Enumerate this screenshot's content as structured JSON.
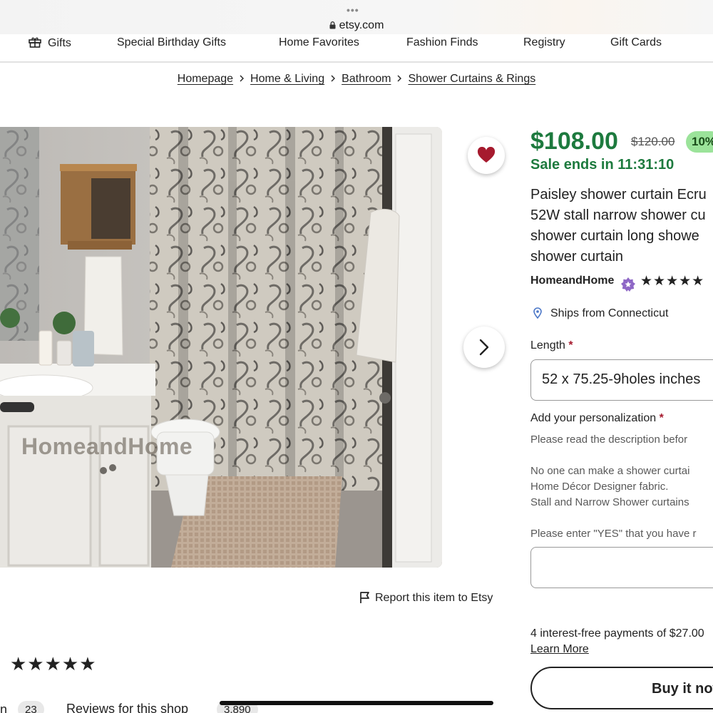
{
  "browser": {
    "url": "etsy.com"
  },
  "nav": {
    "items": [
      {
        "label": "Gifts"
      },
      {
        "label": "Special Birthday Gifts"
      },
      {
        "label": "Home Favorites"
      },
      {
        "label": "Fashion Finds"
      },
      {
        "label": "Registry"
      },
      {
        "label": "Gift Cards"
      }
    ]
  },
  "breadcrumb": [
    "Homepage",
    "Home & Living",
    "Bathroom",
    "Shower Curtains & Rings"
  ],
  "image": {
    "watermark": "HomeandHome",
    "icons": {
      "favorite": "heart-icon",
      "next": "chevron-right-icon"
    }
  },
  "report_link": "Report this item to Etsy",
  "reviews": {
    "left_fragment": "n",
    "item_count": "23",
    "shop_label": "Reviews for this shop",
    "shop_count": "3,890",
    "stars": "★★★★★"
  },
  "product": {
    "price": "$108.00",
    "original_price": "$120.00",
    "discount": "10%",
    "sale_ends": "Sale ends in 11:31:10",
    "title_lines": [
      "Paisley shower curtain Ecru",
      "52W stall narrow shower cu",
      "shower curtain long showe",
      "shower curtain"
    ],
    "shop_name": "HomeandHome",
    "shop_stars": "★★★★★",
    "ships_from": "Ships from Connecticut",
    "colors": {
      "price": "#1d7a3e",
      "discount_bg": "#9be39a",
      "required": "#a61a2e"
    }
  },
  "options": {
    "length_label": "Length",
    "length_value": "52 x 75.25-9holes inches",
    "required_mark": "*",
    "personalization_label": "Add your personalization",
    "personalization_lines": [
      "Please read the description befor",
      "No one can make a shower curtai",
      "Home Décor Designer fabric.",
      "Stall and Narrow Shower curtains",
      "Please enter \"YES\" that you have r"
    ]
  },
  "payment": {
    "installments": "4 interest-free payments of $27.00",
    "learn_more": "Learn More",
    "buy_now": "Buy it now"
  }
}
